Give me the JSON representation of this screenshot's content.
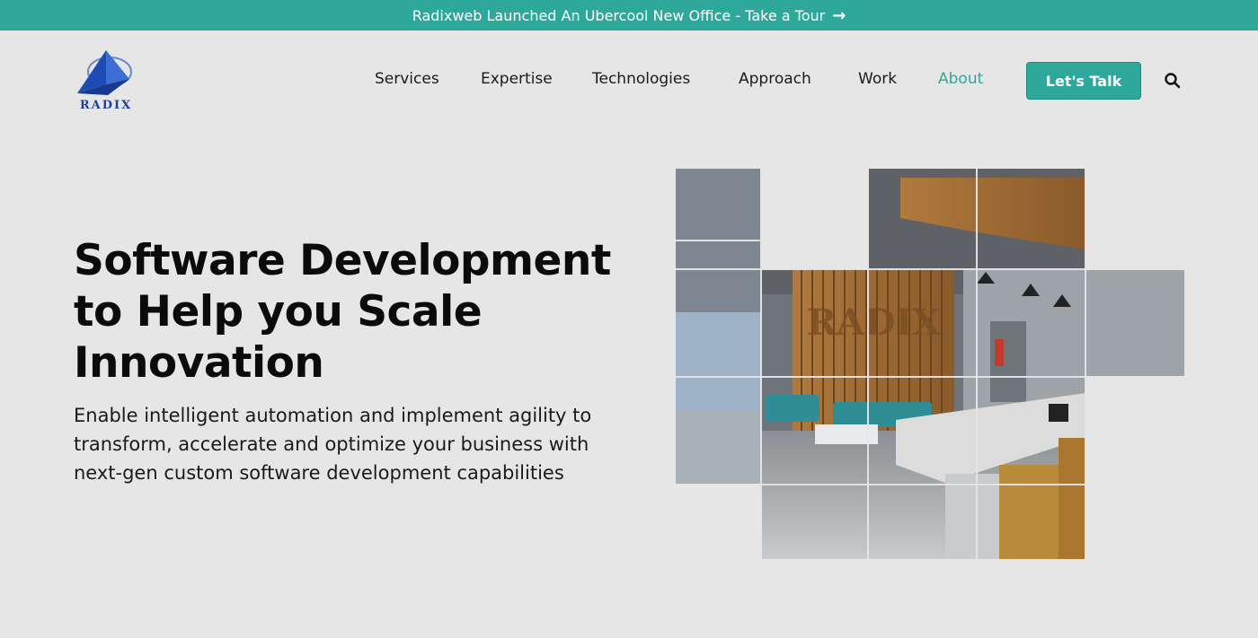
{
  "announcement": {
    "text": "Radixweb Launched An Ubercool New Office - Take a Tour",
    "arrow": "→"
  },
  "logo": {
    "text": "RADIX"
  },
  "nav": {
    "items": [
      {
        "label": "Services",
        "active": false
      },
      {
        "label": "Expertise",
        "active": false
      },
      {
        "label": "Technologies",
        "active": false
      },
      {
        "label": "Approach",
        "active": false
      },
      {
        "label": "Work",
        "active": false
      },
      {
        "label": "About",
        "active": true
      }
    ],
    "cta_label": "Let's Talk",
    "search_icon": "search-icon"
  },
  "hero": {
    "title": "Software Development to Help you Scale Innovation",
    "subtitle": "Enable intelligent automation and implement agility to transform, accelerate and optimize your business with next-gen custom software development capabilities",
    "image": {
      "wall_text": "RADIX"
    }
  },
  "colors": {
    "accent": "#2ea89a",
    "background": "#e6e6e6",
    "logo_blue": "#1e3f9e"
  }
}
